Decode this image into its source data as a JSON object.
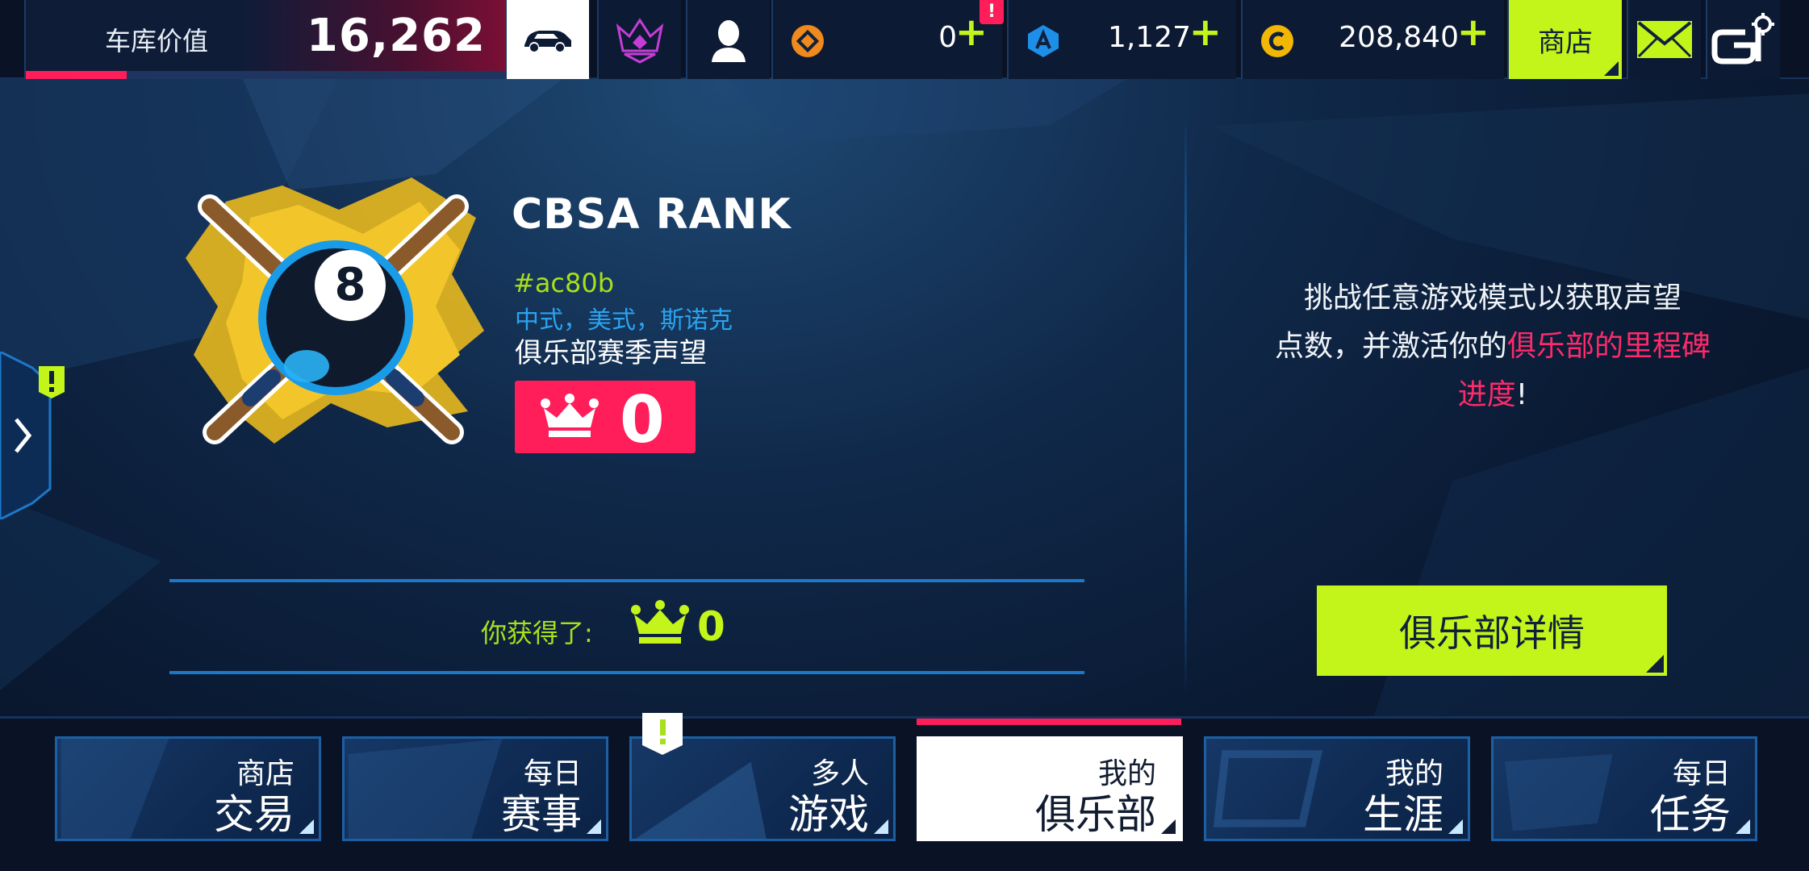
{
  "topbar": {
    "garage_label": "车库价值",
    "garage_value": "16,262",
    "garage_progress": 0.21,
    "tokens_value": "0",
    "tokens_alert": "!",
    "apoints_value": "1,127",
    "credits_value": "208,840",
    "plus": "+",
    "shop_label": "商店"
  },
  "side_alert": "!",
  "rank": {
    "title": "CBSA RANK",
    "tag": "#ac80b",
    "modes": "中式，美式，斯诺克",
    "season_label": "俱乐部赛季声望",
    "prestige_value": "0"
  },
  "earned": {
    "label": "你获得了:",
    "value": "0"
  },
  "info": {
    "line1": "挑战任意游戏模式以获取声望",
    "line2_prefix": "点数，并激活你的",
    "line2_highlight": "俱乐部的里程碑",
    "line3_highlight": "进度",
    "line3_suffix": "!"
  },
  "club_details_label": "俱乐部详情",
  "nav": {
    "alert": "!",
    "items": [
      {
        "line1": "商店",
        "line2": "交易"
      },
      {
        "line1": "每日",
        "line2": "赛事"
      },
      {
        "line1": "多人",
        "line2": "游戏"
      },
      {
        "line1": "我的",
        "line2": "俱乐部"
      },
      {
        "line1": "我的",
        "line2": "生涯"
      },
      {
        "line1": "每日",
        "line2": "任务"
      }
    ],
    "active_index": 3
  },
  "colors": {
    "accent_lime": "#c4f51a",
    "accent_pink": "#ff1e5a",
    "accent_blue": "#1d78c8",
    "mode_text_blue": "#2aa3f0"
  }
}
